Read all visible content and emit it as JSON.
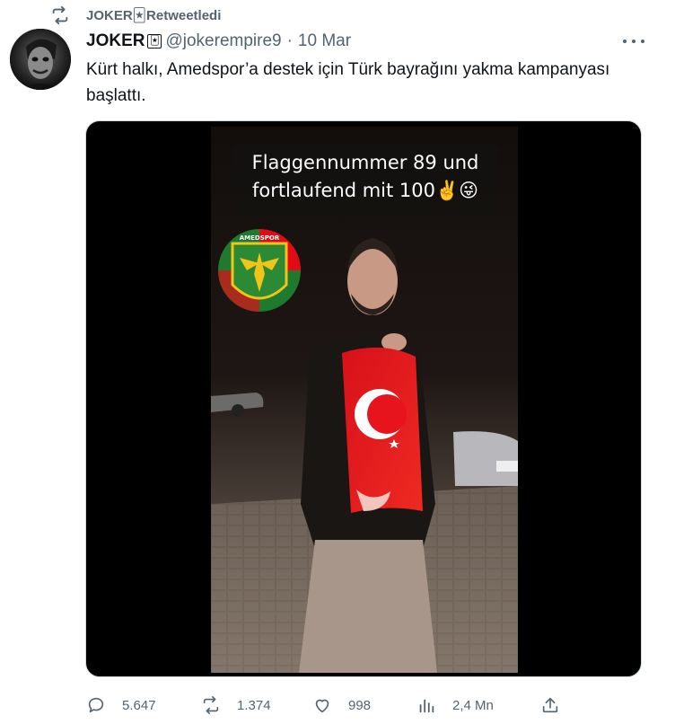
{
  "retweet_banner": {
    "text": "JOKER🃏Retweetledi"
  },
  "tweet": {
    "display_name": "JOKER",
    "badge": "🃏",
    "handle": "@jokerempire9",
    "separator": "·",
    "timestamp": "10 Mar",
    "text": "Kürt halkı, Amedspor’a destek için Türk bayrağını yakma kampanyası başlattı."
  },
  "media": {
    "caption": "Flaggennummer 89 und\nfortlaufend mit 100✌️😜",
    "logo_text": "AMEDSPOR",
    "colors": {
      "flag_red": "#e30a17",
      "logo_green": "#1e7a2e"
    }
  },
  "actions": {
    "replies": "5.647",
    "retweets": "1.374",
    "likes": "998",
    "views": "2,4 Mn"
  },
  "icons": [
    "retweet-icon",
    "more-icon",
    "reply-icon",
    "like-icon",
    "views-icon",
    "share-icon"
  ],
  "colors": {
    "text": "#0f1419",
    "secondary": "#536471",
    "border": "#cfd9de"
  }
}
